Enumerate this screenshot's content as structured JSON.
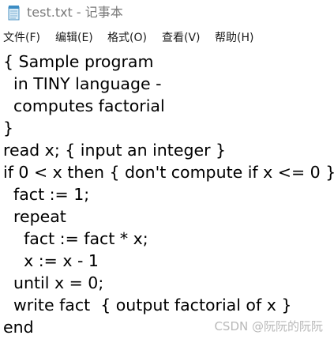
{
  "window": {
    "title": "test.txt - 记事本",
    "icon": "notepad-icon"
  },
  "menu": [
    {
      "label": "文件(F)"
    },
    {
      "label": "编辑(E)"
    },
    {
      "label": "格式(O)"
    },
    {
      "label": "查看(V)"
    },
    {
      "label": "帮助(H)"
    }
  ],
  "editor": {
    "lines": [
      "{ Sample program",
      "  in TINY language -",
      "  computes factorial",
      "}",
      "read x; { input an integer }",
      "if 0 < x then { don't compute if x <= 0 }",
      "  fact := 1;",
      "  repeat",
      "    fact := fact * x;",
      "    x := x - 1",
      "  until x = 0;",
      "  write fact  { output factorial of x }",
      "end"
    ]
  },
  "watermark": {
    "text": "CSDN @阮阮的阮阮"
  }
}
